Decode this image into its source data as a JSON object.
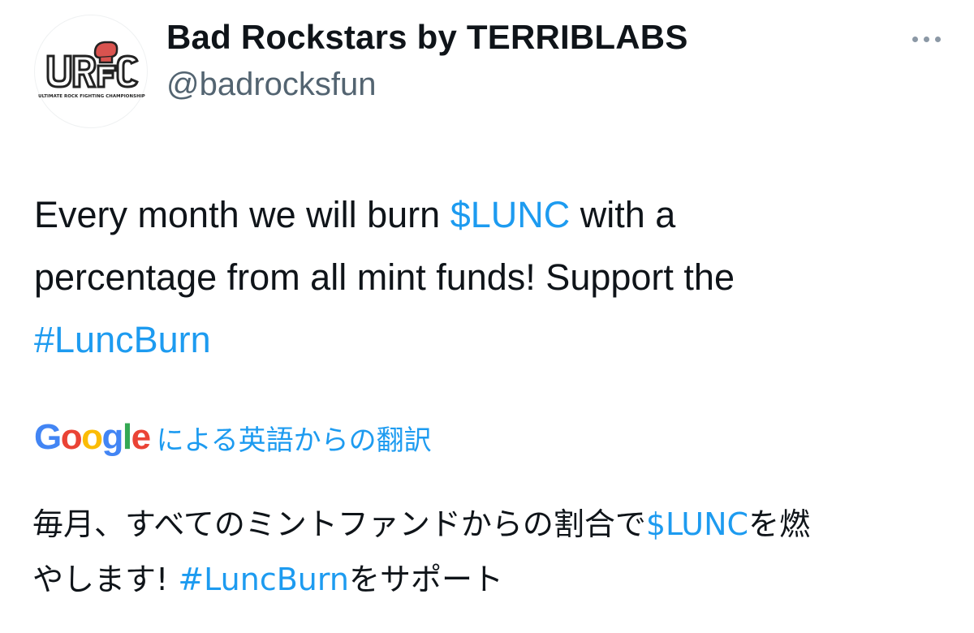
{
  "author": {
    "display_name": "Bad Rockstars by TERRIBLABS",
    "handle": "@badrocksfun",
    "avatar": {
      "logo_text": "UR FC",
      "logo_subtext": "ULTIMATE ROCK FIGHTING CHAMPIONSHIP"
    }
  },
  "more_button": {
    "icon": "more-horizontal-icon"
  },
  "tweet": {
    "line1_pre": "Every month we will burn ",
    "cashtag": "$LUNC",
    "line1_post": " with a",
    "line2": "percentage from all mint funds! Support the",
    "hashtag": "#LuncBurn"
  },
  "translation": {
    "google_letters": [
      "G",
      "o",
      "o",
      "g",
      "l",
      "e"
    ],
    "label": "による英語からの翻訳"
  },
  "translated": {
    "line1_pre": "毎月、すべてのミントファンドからの割合で",
    "cashtag": "$LUNC",
    "line1_post": "を燃",
    "line2_pre": "やします! ",
    "hashtag": "#LuncBurn",
    "line2_post": "をサポート"
  },
  "colors": {
    "link": "#1d9bf0",
    "text": "#0f1419",
    "secondary": "#536471",
    "google_blue": "#4285f4",
    "google_red": "#ea4335",
    "google_yellow": "#fbbc05",
    "google_green": "#34a853"
  }
}
